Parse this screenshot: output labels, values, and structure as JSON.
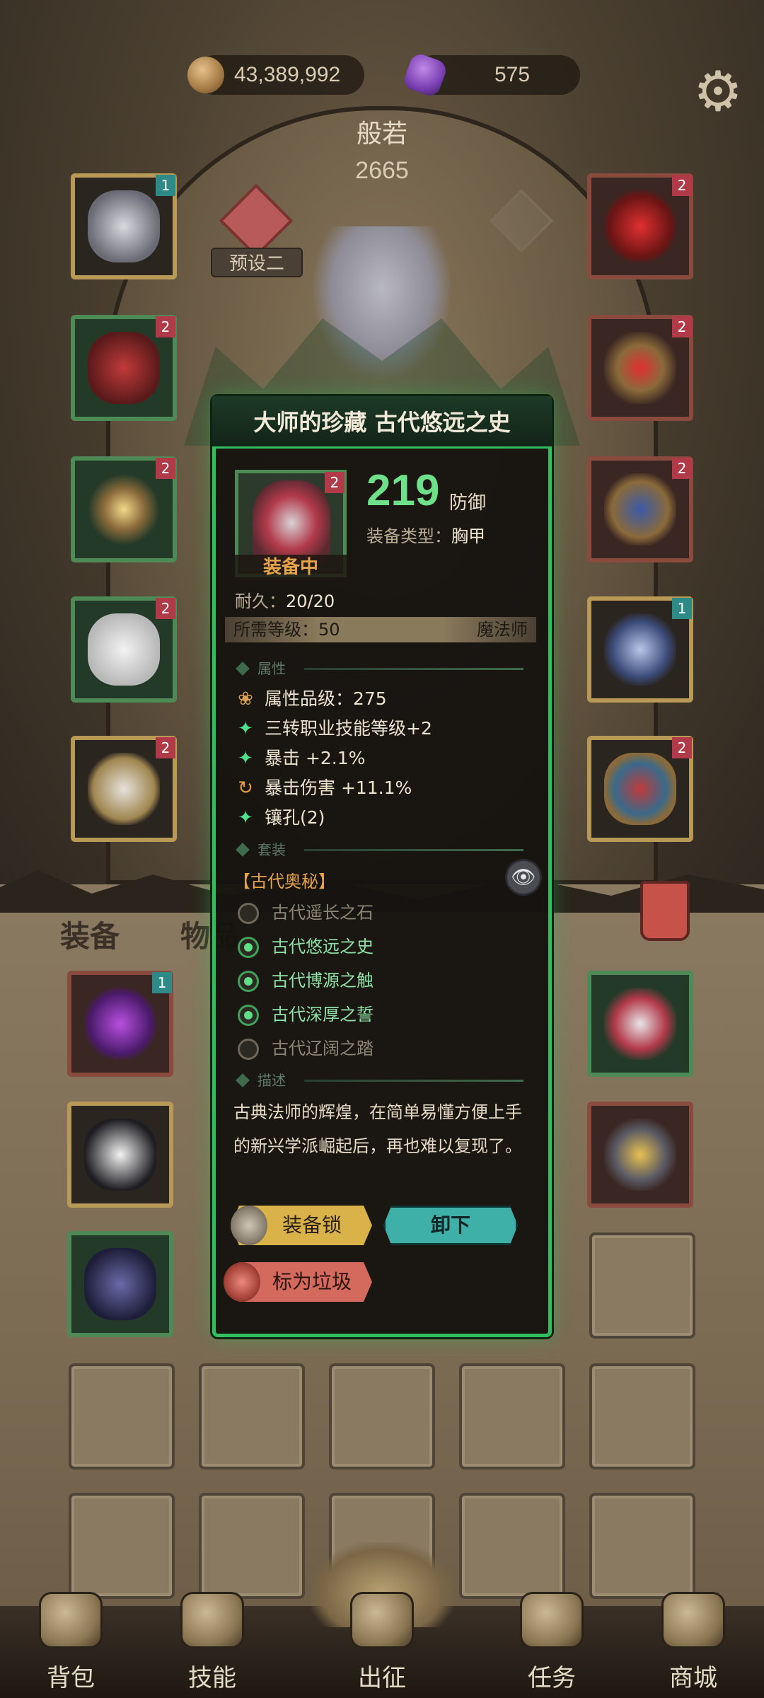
{
  "currencies": {
    "gold": {
      "icon": "coin-icon",
      "value": "43,389,992"
    },
    "gems": {
      "icon": "gem-icon",
      "value": "575"
    }
  },
  "character": {
    "name": "般若",
    "power": "2665",
    "preset_label": "预设二"
  },
  "equipment_left": [
    {
      "name": "headgear",
      "level": "1",
      "badge": "teal",
      "frame": "gold"
    },
    {
      "name": "cape",
      "level": "2",
      "badge": "red",
      "frame": "green"
    },
    {
      "name": "amulet-star",
      "level": "2",
      "badge": "red",
      "frame": "green"
    },
    {
      "name": "pants",
      "level": "2",
      "badge": "red",
      "frame": "green"
    },
    {
      "name": "boots",
      "level": "2",
      "badge": "red",
      "frame": "gold"
    }
  ],
  "equipment_right": [
    {
      "name": "necklace",
      "level": "2",
      "badge": "red",
      "frame": "red"
    },
    {
      "name": "ring-red",
      "level": "2",
      "badge": "red",
      "frame": "red"
    },
    {
      "name": "gauntlet",
      "level": "2",
      "badge": "red",
      "frame": "red"
    },
    {
      "name": "sword",
      "level": "1",
      "badge": "teal",
      "frame": "gold"
    },
    {
      "name": "spellbook",
      "level": "2",
      "badge": "red",
      "frame": "gold"
    }
  ],
  "tabs": {
    "equipment": "装备",
    "items": "物品"
  },
  "popup": {
    "title": "大师的珍藏 古代悠远之史",
    "item_level": "2",
    "equipped_label": "装备中",
    "stat_value": "219",
    "stat_unit": "防御",
    "type_label": "装备类型：",
    "type_value": "胸甲",
    "durability_label": "耐久：",
    "durability_value": "20/20",
    "req_level": "所需等级：50",
    "req_class": "魔法师",
    "section_attributes": "属性",
    "attributes": [
      {
        "icon": "lotus-icon",
        "text": "属性品级：275"
      },
      {
        "icon": "sparkle-icon",
        "text": "三转职业技能等级+2"
      },
      {
        "icon": "sparkle-icon",
        "text": "暴击 +2.1%"
      },
      {
        "icon": "cycle-icon",
        "text": "暴击伤害 +11.1%"
      },
      {
        "icon": "sparkle-icon",
        "text": "镶孔(2)"
      }
    ],
    "section_set": "套装",
    "set_name": "【古代奥秘】",
    "set_items": [
      {
        "name": "古代遥长之石",
        "active": false
      },
      {
        "name": "古代悠远之史",
        "active": true
      },
      {
        "name": "古代博源之触",
        "active": true
      },
      {
        "name": "古代深厚之誓",
        "active": true
      },
      {
        "name": "古代辽阔之踏",
        "active": false
      }
    ],
    "section_description": "描述",
    "description": "古典法师的辉煌，在简单易懂方便上手的新兴学派崛起后，再也难以复现了。",
    "buttons": {
      "lock": "装备锁",
      "unequip": "卸下",
      "junk": "标为垃圾"
    }
  },
  "nav": [
    {
      "label": "背包",
      "icon": "backpack-icon"
    },
    {
      "label": "技能",
      "icon": "skill-book-icon"
    },
    {
      "label": "出征",
      "icon": "sword-icon"
    },
    {
      "label": "任务",
      "icon": "scroll-icon"
    },
    {
      "label": "商城",
      "icon": "shop-icon"
    }
  ]
}
